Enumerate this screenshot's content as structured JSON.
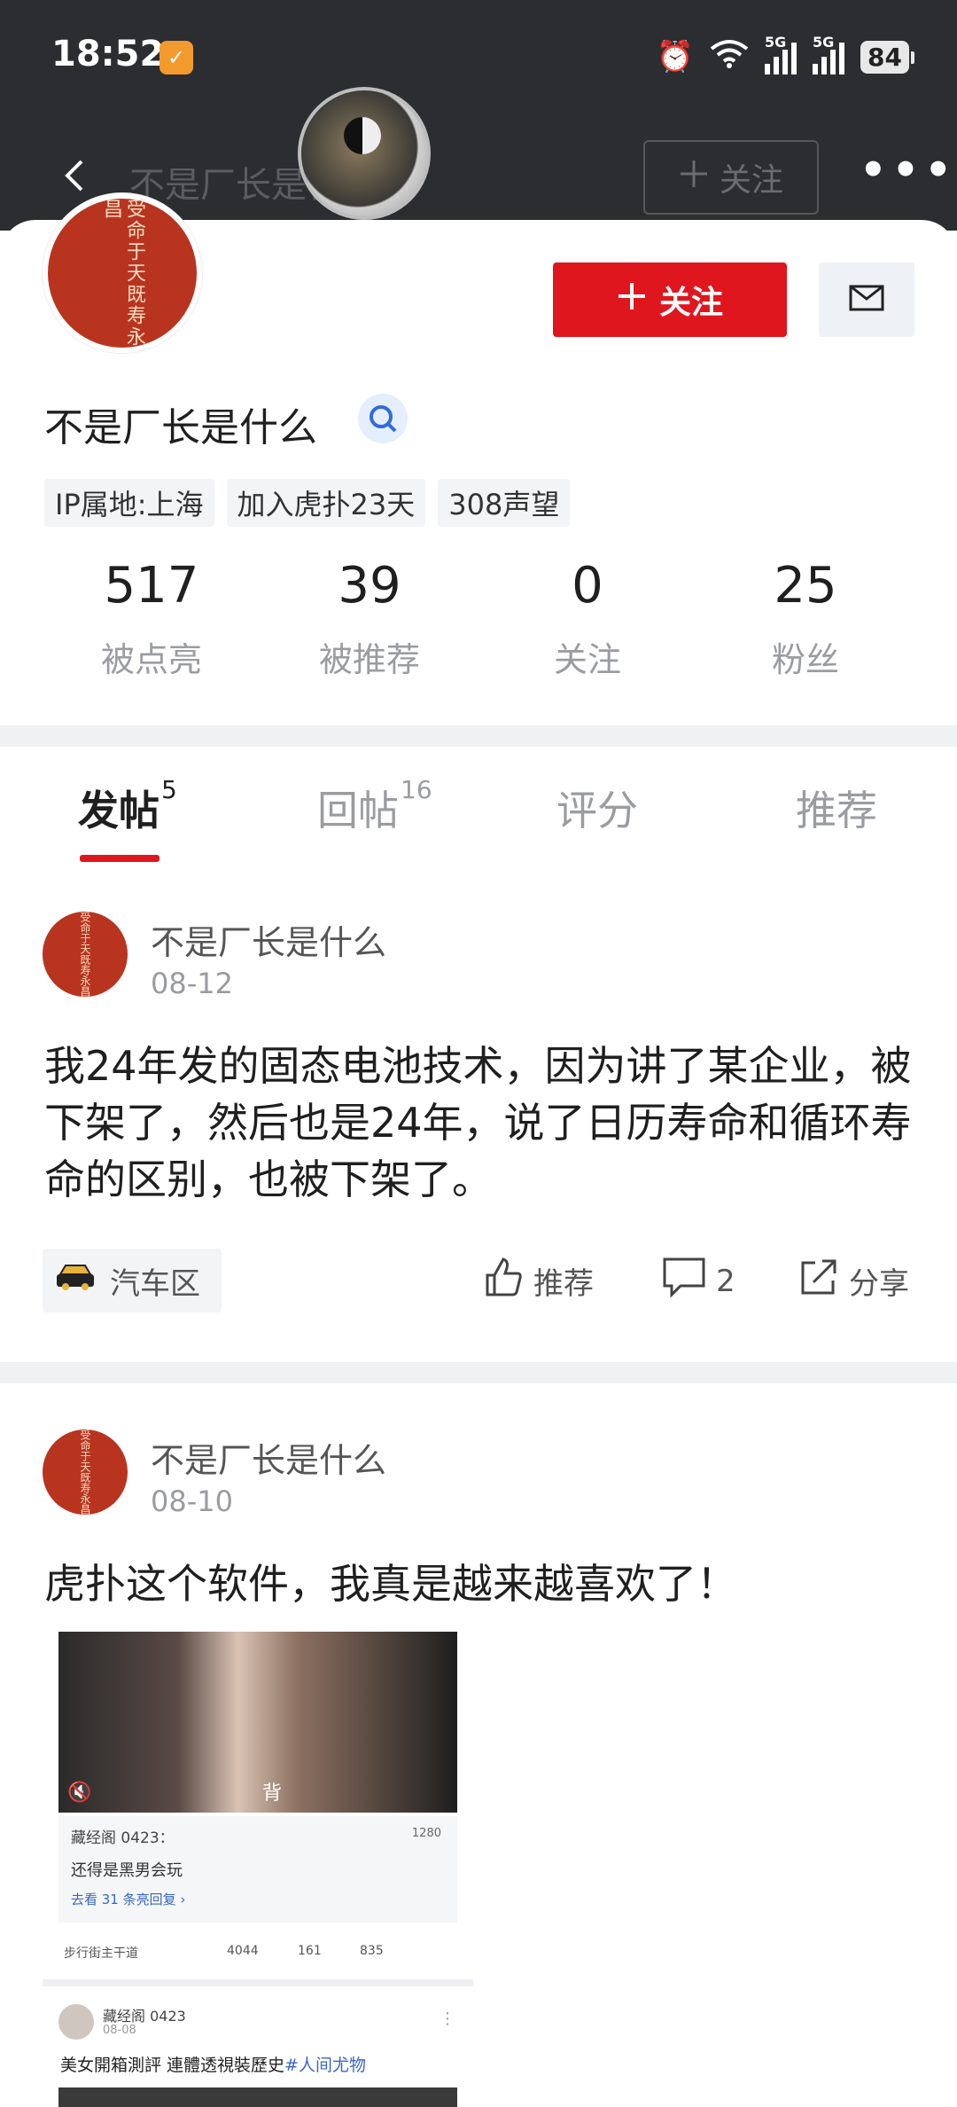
{
  "status_bar": {
    "time": "18:52",
    "signal1_label": "5G",
    "signal2_label": "5G",
    "battery": "84"
  },
  "nav": {
    "title": "不是厂长是什么",
    "follow_label": "关注",
    "more": "•••"
  },
  "profile": {
    "avatar_seal_text": "受命于天既寿永昌",
    "follow_button": "关注",
    "username": "不是厂长是什么",
    "tags": [
      "IP属地:上海",
      "加入虎扑23天",
      "308声望"
    ],
    "stats": [
      {
        "value": "517",
        "label": "被点亮"
      },
      {
        "value": "39",
        "label": "被推荐"
      },
      {
        "value": "0",
        "label": "关注"
      },
      {
        "value": "25",
        "label": "粉丝"
      }
    ]
  },
  "tabs": [
    {
      "label": "发帖",
      "count": "5"
    },
    {
      "label": "回帖",
      "count": "16"
    },
    {
      "label": "评分",
      "count": ""
    },
    {
      "label": "推荐",
      "count": ""
    }
  ],
  "posts": [
    {
      "author": "不是厂长是什么",
      "date": "08-12",
      "text": "我24年发的固态电池技术，因为讲了某企业，被下架了，然后也是24年，说了日历寿命和循环寿命的区别，也被下架了。",
      "zone": "汽车区",
      "recommend": "推荐",
      "comments": "2",
      "share": "分享"
    },
    {
      "author": "不是厂长是什么",
      "date": "08-10",
      "text": "虎扑这个软件，我真是越来越喜欢了！",
      "embed": {
        "video_caption": "背",
        "comment_user": "藏经阁 0423：",
        "comment_likes": "1280",
        "comment_text": "还得是黑男会玩",
        "comment_more": "去看 31 条亮回复 ›",
        "zone": "步行街主干道",
        "likes": "4044",
        "comments": "161",
        "shares": "835",
        "post_user": "藏经阁 0423",
        "post_date": "08-08",
        "post_title": "美女開箱測評 連體透視裝歷史",
        "post_hashtag": "#人间尤物"
      }
    }
  ],
  "colors": {
    "accent_red": "#e0161f",
    "header_dark": "#2b2d31",
    "seal_red": "#b8341f"
  }
}
